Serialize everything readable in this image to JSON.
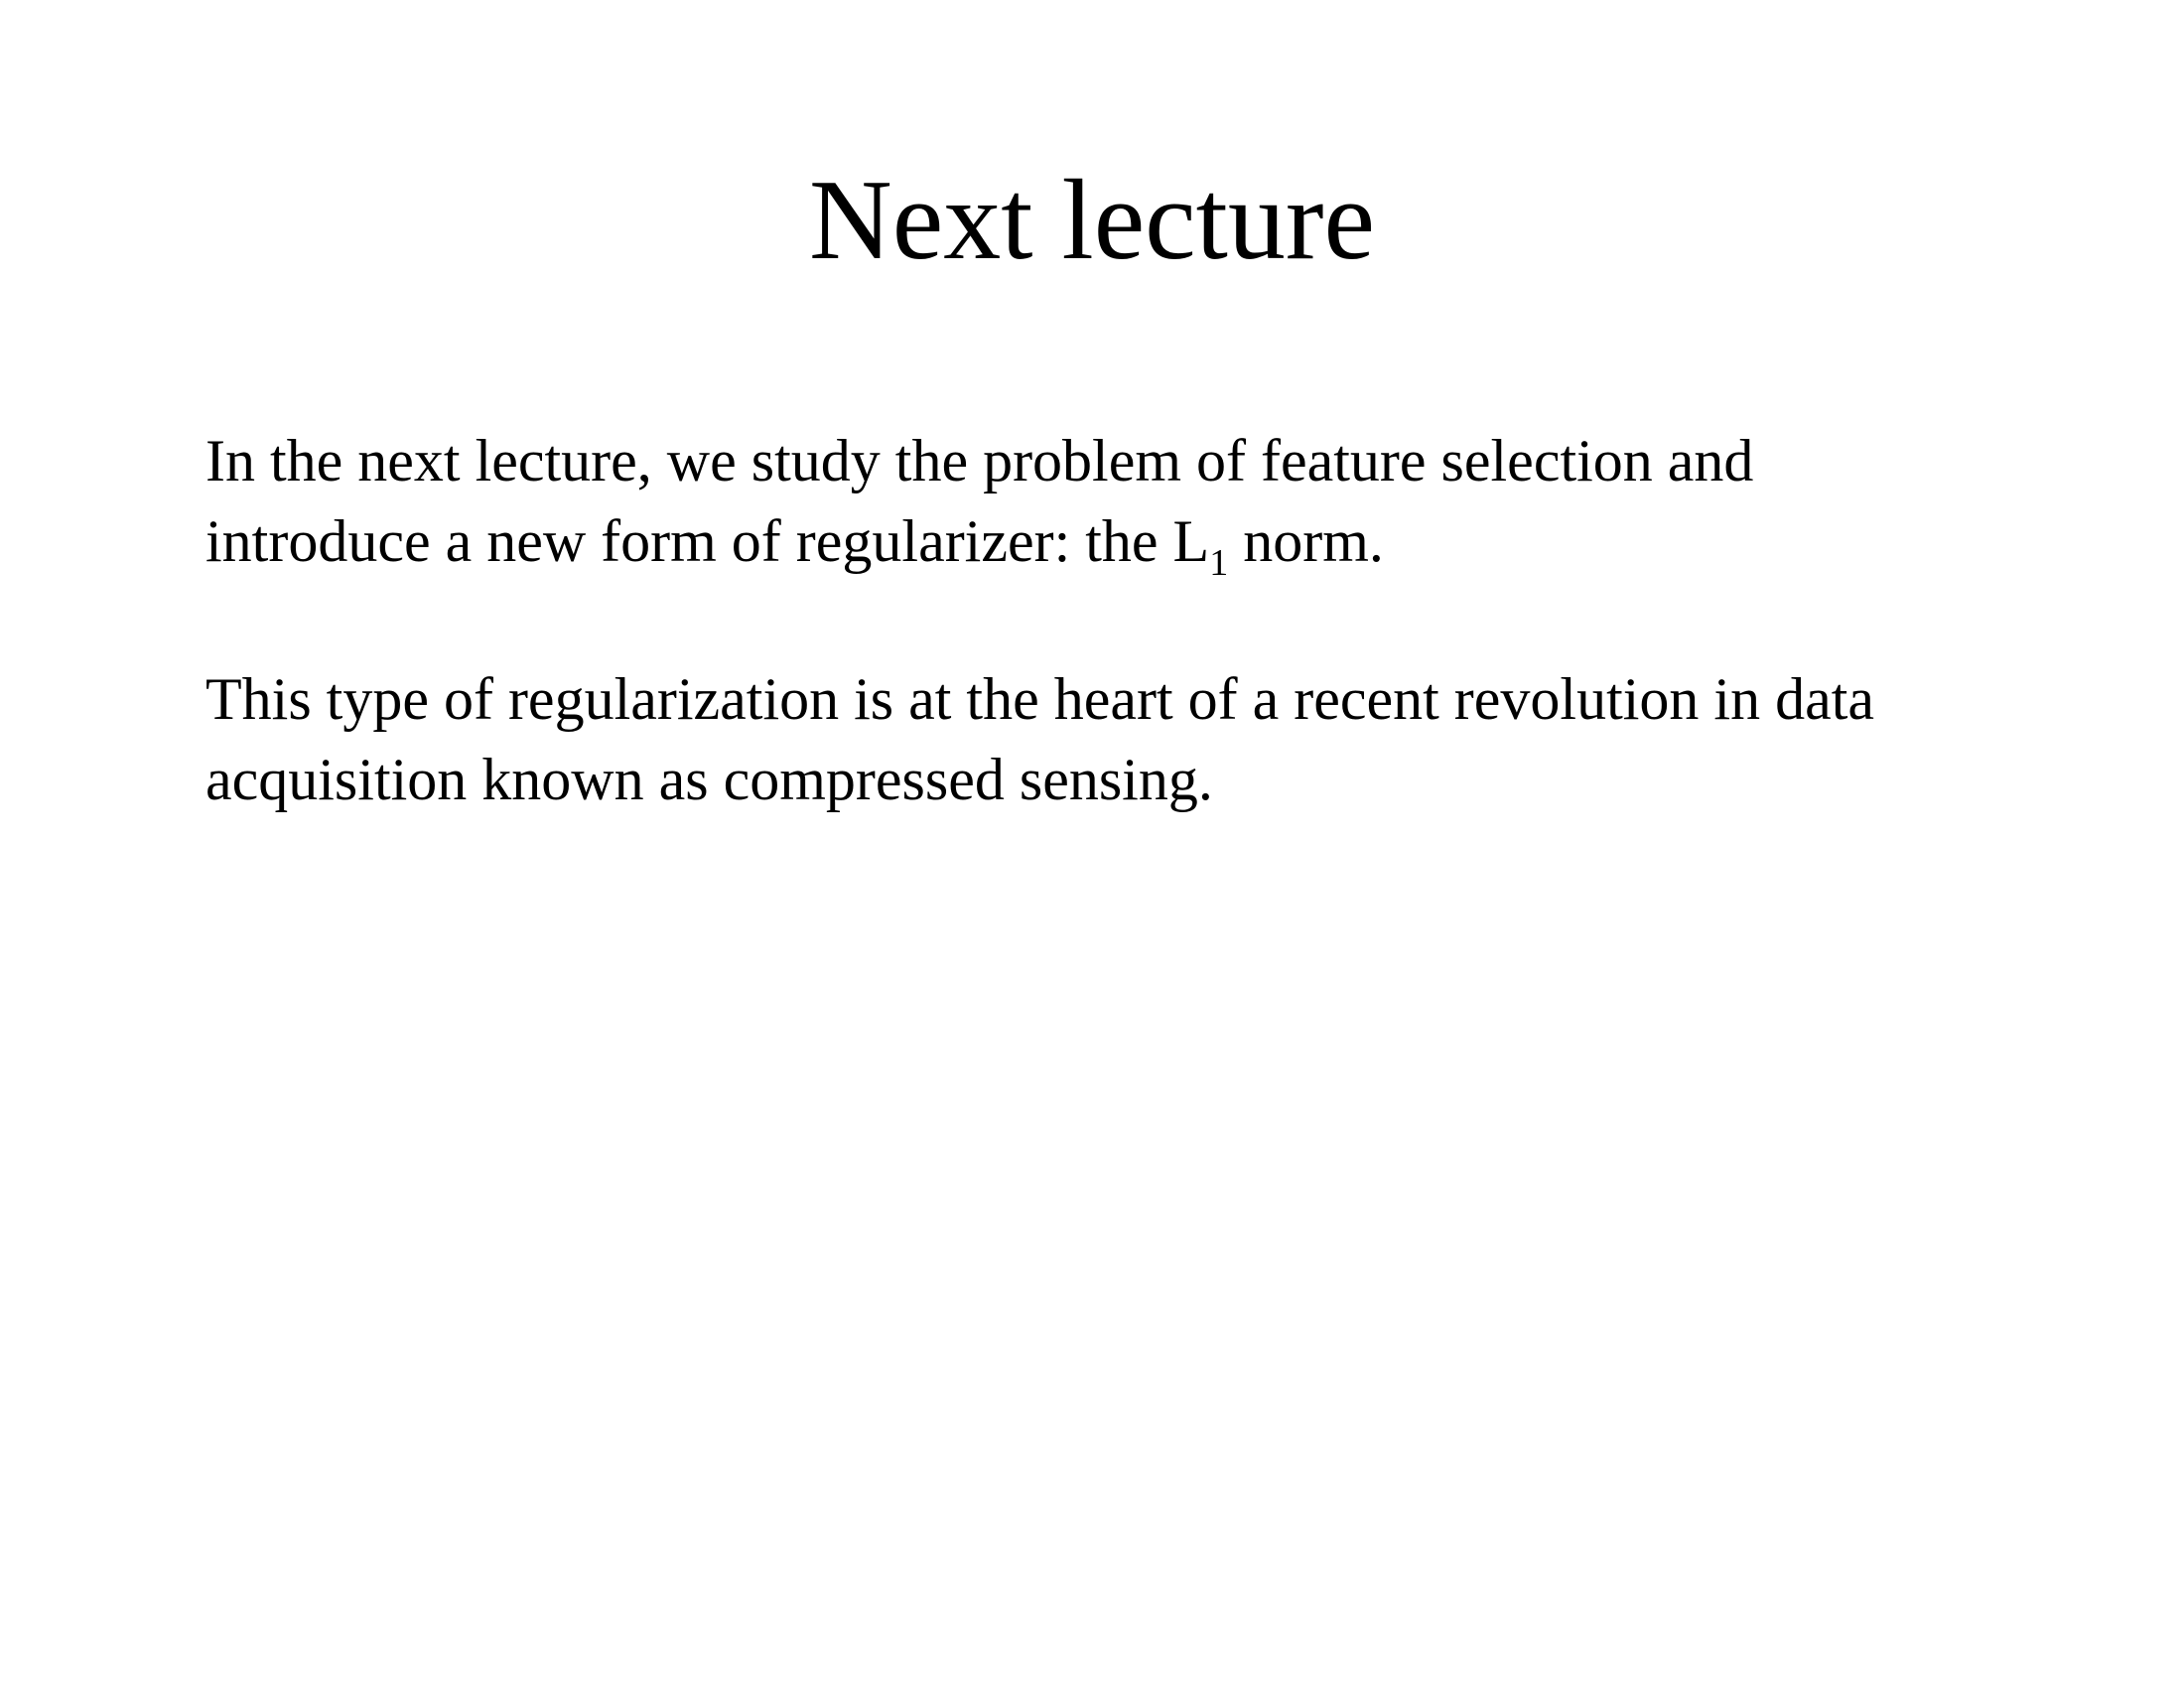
{
  "slide": {
    "title": "Next lecture",
    "paragraph_1": {
      "line_1": "In the next lecture, we study the problem of feature selection and",
      "line_2_before": "introduce a new form of regularizer: the L",
      "line_2_subscript": "1",
      "line_2_after": " norm."
    },
    "paragraph_2": {
      "line_1": "This type of regularization is at the heart of a recent revolution in data",
      "line_2": "acquisition known as compressed sensing."
    }
  }
}
